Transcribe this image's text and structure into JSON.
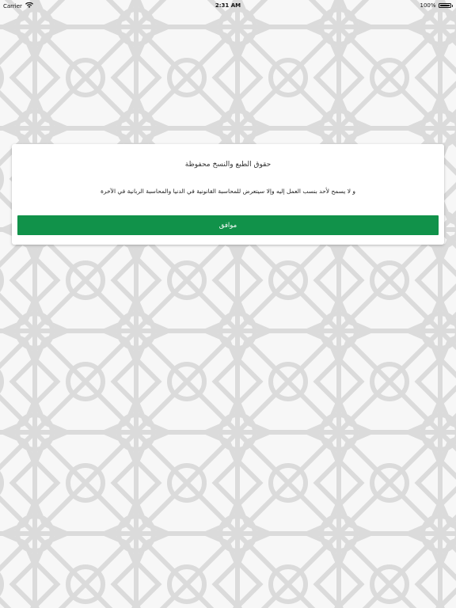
{
  "status_bar": {
    "carrier": "Carrier",
    "time": "2:31 AM",
    "battery": "100%",
    "battery_level": 1.0
  },
  "icons": {
    "wifi": "wifi-icon",
    "battery": "battery-icon"
  },
  "dialog": {
    "title": "حقوق الطبع والنسخ محفوظة",
    "message": "و لا يسمح لأحد بنسب العمل إليه وإلا سيتعرض للمحاسبة القانونية في الدنيا والمحاسبة الربانية في الآخرة",
    "ok_button_label": "موافق"
  },
  "colors": {
    "accent": "#11924a",
    "background": "#f7f7f7",
    "pattern_lines": "#d9d9d9"
  }
}
